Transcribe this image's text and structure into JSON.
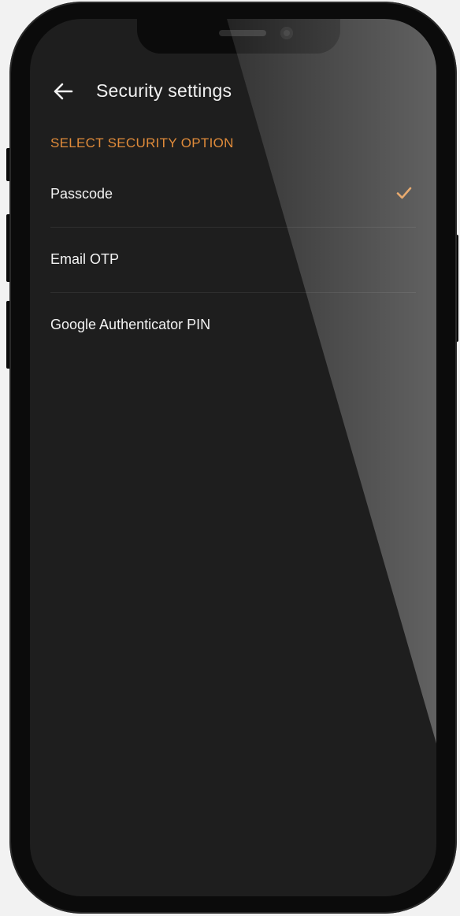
{
  "app_bar": {
    "title": "Security settings",
    "back_icon": "arrow-left-icon"
  },
  "section": {
    "header": "SELECT SECURITY OPTION"
  },
  "options": [
    {
      "label": "Passcode",
      "selected": true
    },
    {
      "label": "Email OTP",
      "selected": false
    },
    {
      "label": "Google Authenticator PIN",
      "selected": false
    }
  ],
  "colors": {
    "accent": "#e08b3a",
    "screen_background": "#1e1e1e",
    "text_primary": "#f3f3f3"
  },
  "icons": {
    "back": "arrow-left-icon",
    "selected": "checkmark-icon"
  }
}
